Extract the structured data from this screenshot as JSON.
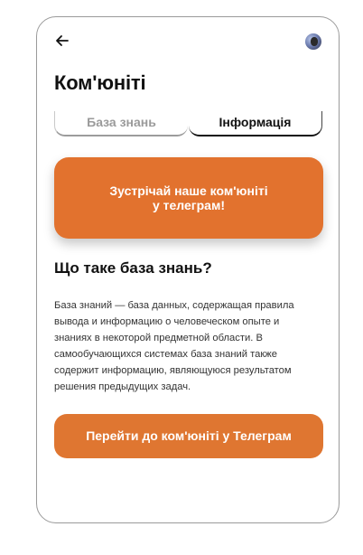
{
  "header": {
    "back_icon": "arrow-left-icon",
    "avatar_icon": "user-avatar"
  },
  "page": {
    "title": "Ком'юніті"
  },
  "tabs": [
    {
      "label": "База знань",
      "active": false
    },
    {
      "label": "Інформація",
      "active": true
    }
  ],
  "promo": {
    "line1": "Зустрічай наше ком'юніті",
    "line2": "у телеграм!"
  },
  "section": {
    "title": "Що таке база знань?",
    "lines": [
      "База знаний — база данных, содержащая правила",
      "вывода и информацию о человеческом опыте и",
      "знаниях в некоторой предметной области. В",
      "самообучающихся системах база знаний также",
      "содержит информацию, являющуюся результатом",
      "решения предыдущих задач."
    ]
  },
  "cta": {
    "label": "Перейти до ком'юніті у Телеграм"
  },
  "colors": {
    "accent": "#e2722e",
    "tab_inactive": "#9a9a9a"
  }
}
